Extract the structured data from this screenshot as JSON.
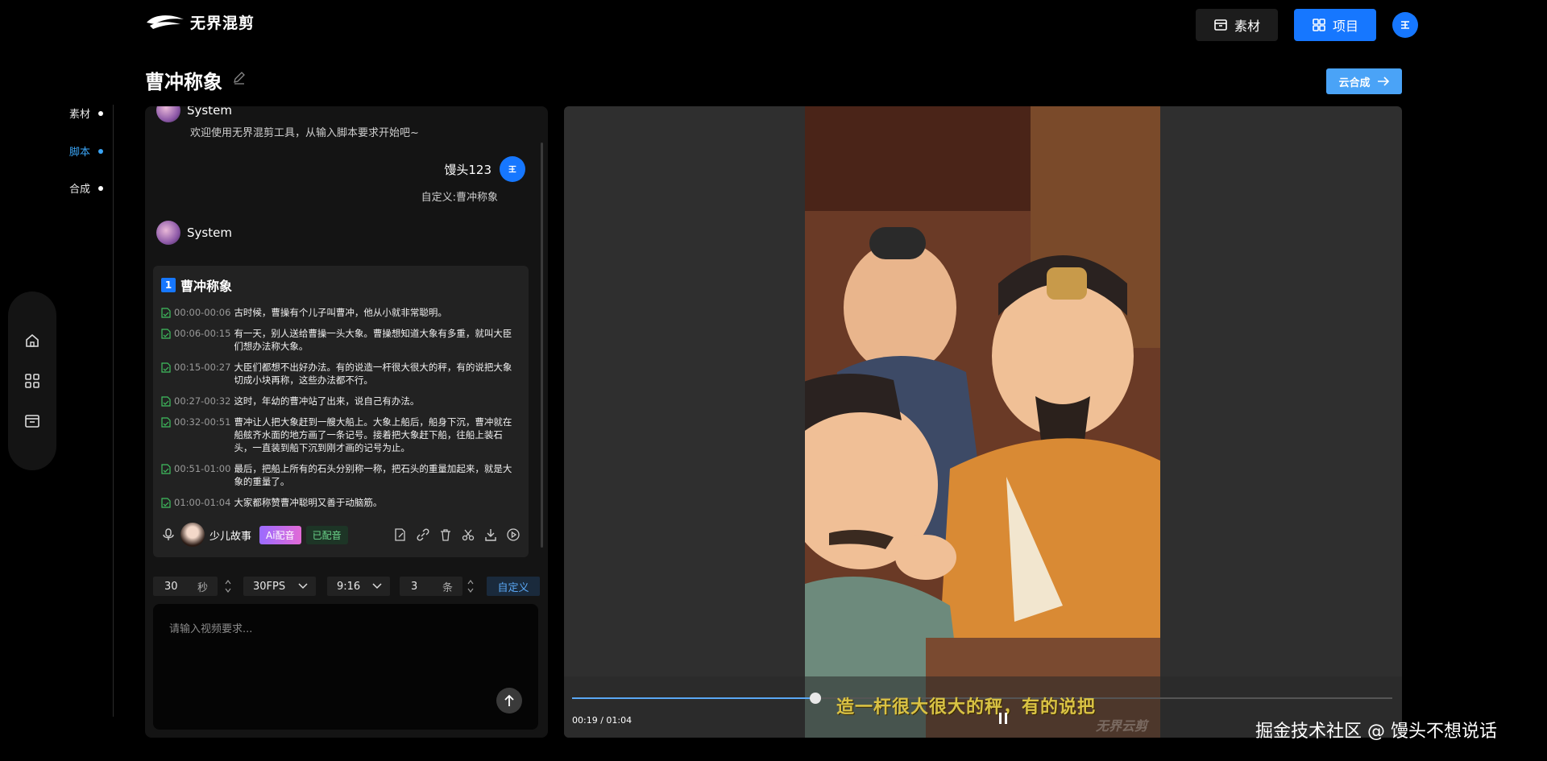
{
  "app": {
    "logo_text": "无界混剪"
  },
  "header": {
    "material_label": "素材",
    "project_label": "项目",
    "cloud_label": "云合成"
  },
  "page": {
    "title": "曹冲称象"
  },
  "steps": [
    {
      "label": "素材"
    },
    {
      "label": "脚本"
    },
    {
      "label": "合成"
    }
  ],
  "chat": {
    "system_name": "System",
    "greeting": "欢迎使用无界混剪工具，从输入脚本要求开始吧~",
    "user_name": "馒头123",
    "user_message": "自定义:曹冲称象",
    "system_name_2": "System"
  },
  "script": {
    "index": "1",
    "title": "曹冲称象",
    "segments": [
      {
        "time": "00:00-00:06",
        "text": "古时候，曹操有个儿子叫曹冲，他从小就非常聪明。"
      },
      {
        "time": "00:06-00:15",
        "text": "有一天，别人送给曹操一头大象。曹操想知道大象有多重，就叫大臣们想办法称大象。"
      },
      {
        "time": "00:15-00:27",
        "text": "大臣们都想不出好办法。有的说造一杆很大很大的秤，有的说把大象切成小块再称，这些办法都不行。"
      },
      {
        "time": "00:27-00:32",
        "text": "这时，年幼的曹冲站了出来，说自己有办法。"
      },
      {
        "time": "00:32-00:51",
        "text": "曹冲让人把大象赶到一艘大船上。大象上船后，船身下沉，曹冲就在船舷齐水面的地方画了一条记号。接着把大象赶下船，往船上装石头，一直装到船下沉到刚才画的记号为止。"
      },
      {
        "time": "00:51-01:00",
        "text": "最后，把船上所有的石头分别称一称，把石头的重量加起来，就是大象的重量了。"
      },
      {
        "time": "01:00-01:04",
        "text": "大家都称赞曹冲聪明又善于动脑筋。"
      }
    ],
    "narrator": "少儿故事",
    "ai_label": "Ai配音",
    "done_label": "已配音"
  },
  "controls": {
    "duration_value": "30",
    "duration_unit": "秒",
    "fps": "30FPS",
    "ratio": "9:16",
    "count_value": "3",
    "count_unit": "条",
    "custom_label": "自定义",
    "input_placeholder": "请输入视频要求..."
  },
  "player": {
    "current": "00:19",
    "total": "01:04",
    "time_text": "00:19 / 01:04",
    "progress": 0.297,
    "subtitle": "造一杆很大很大的秤，有的说把",
    "video_watermark": "无界云剪"
  },
  "watermark": "掘金技术社区 @ 馒头不想说话",
  "colors": {
    "accent": "#1677ff",
    "link": "#3aa4f5",
    "subtitle": "#d9c244"
  }
}
